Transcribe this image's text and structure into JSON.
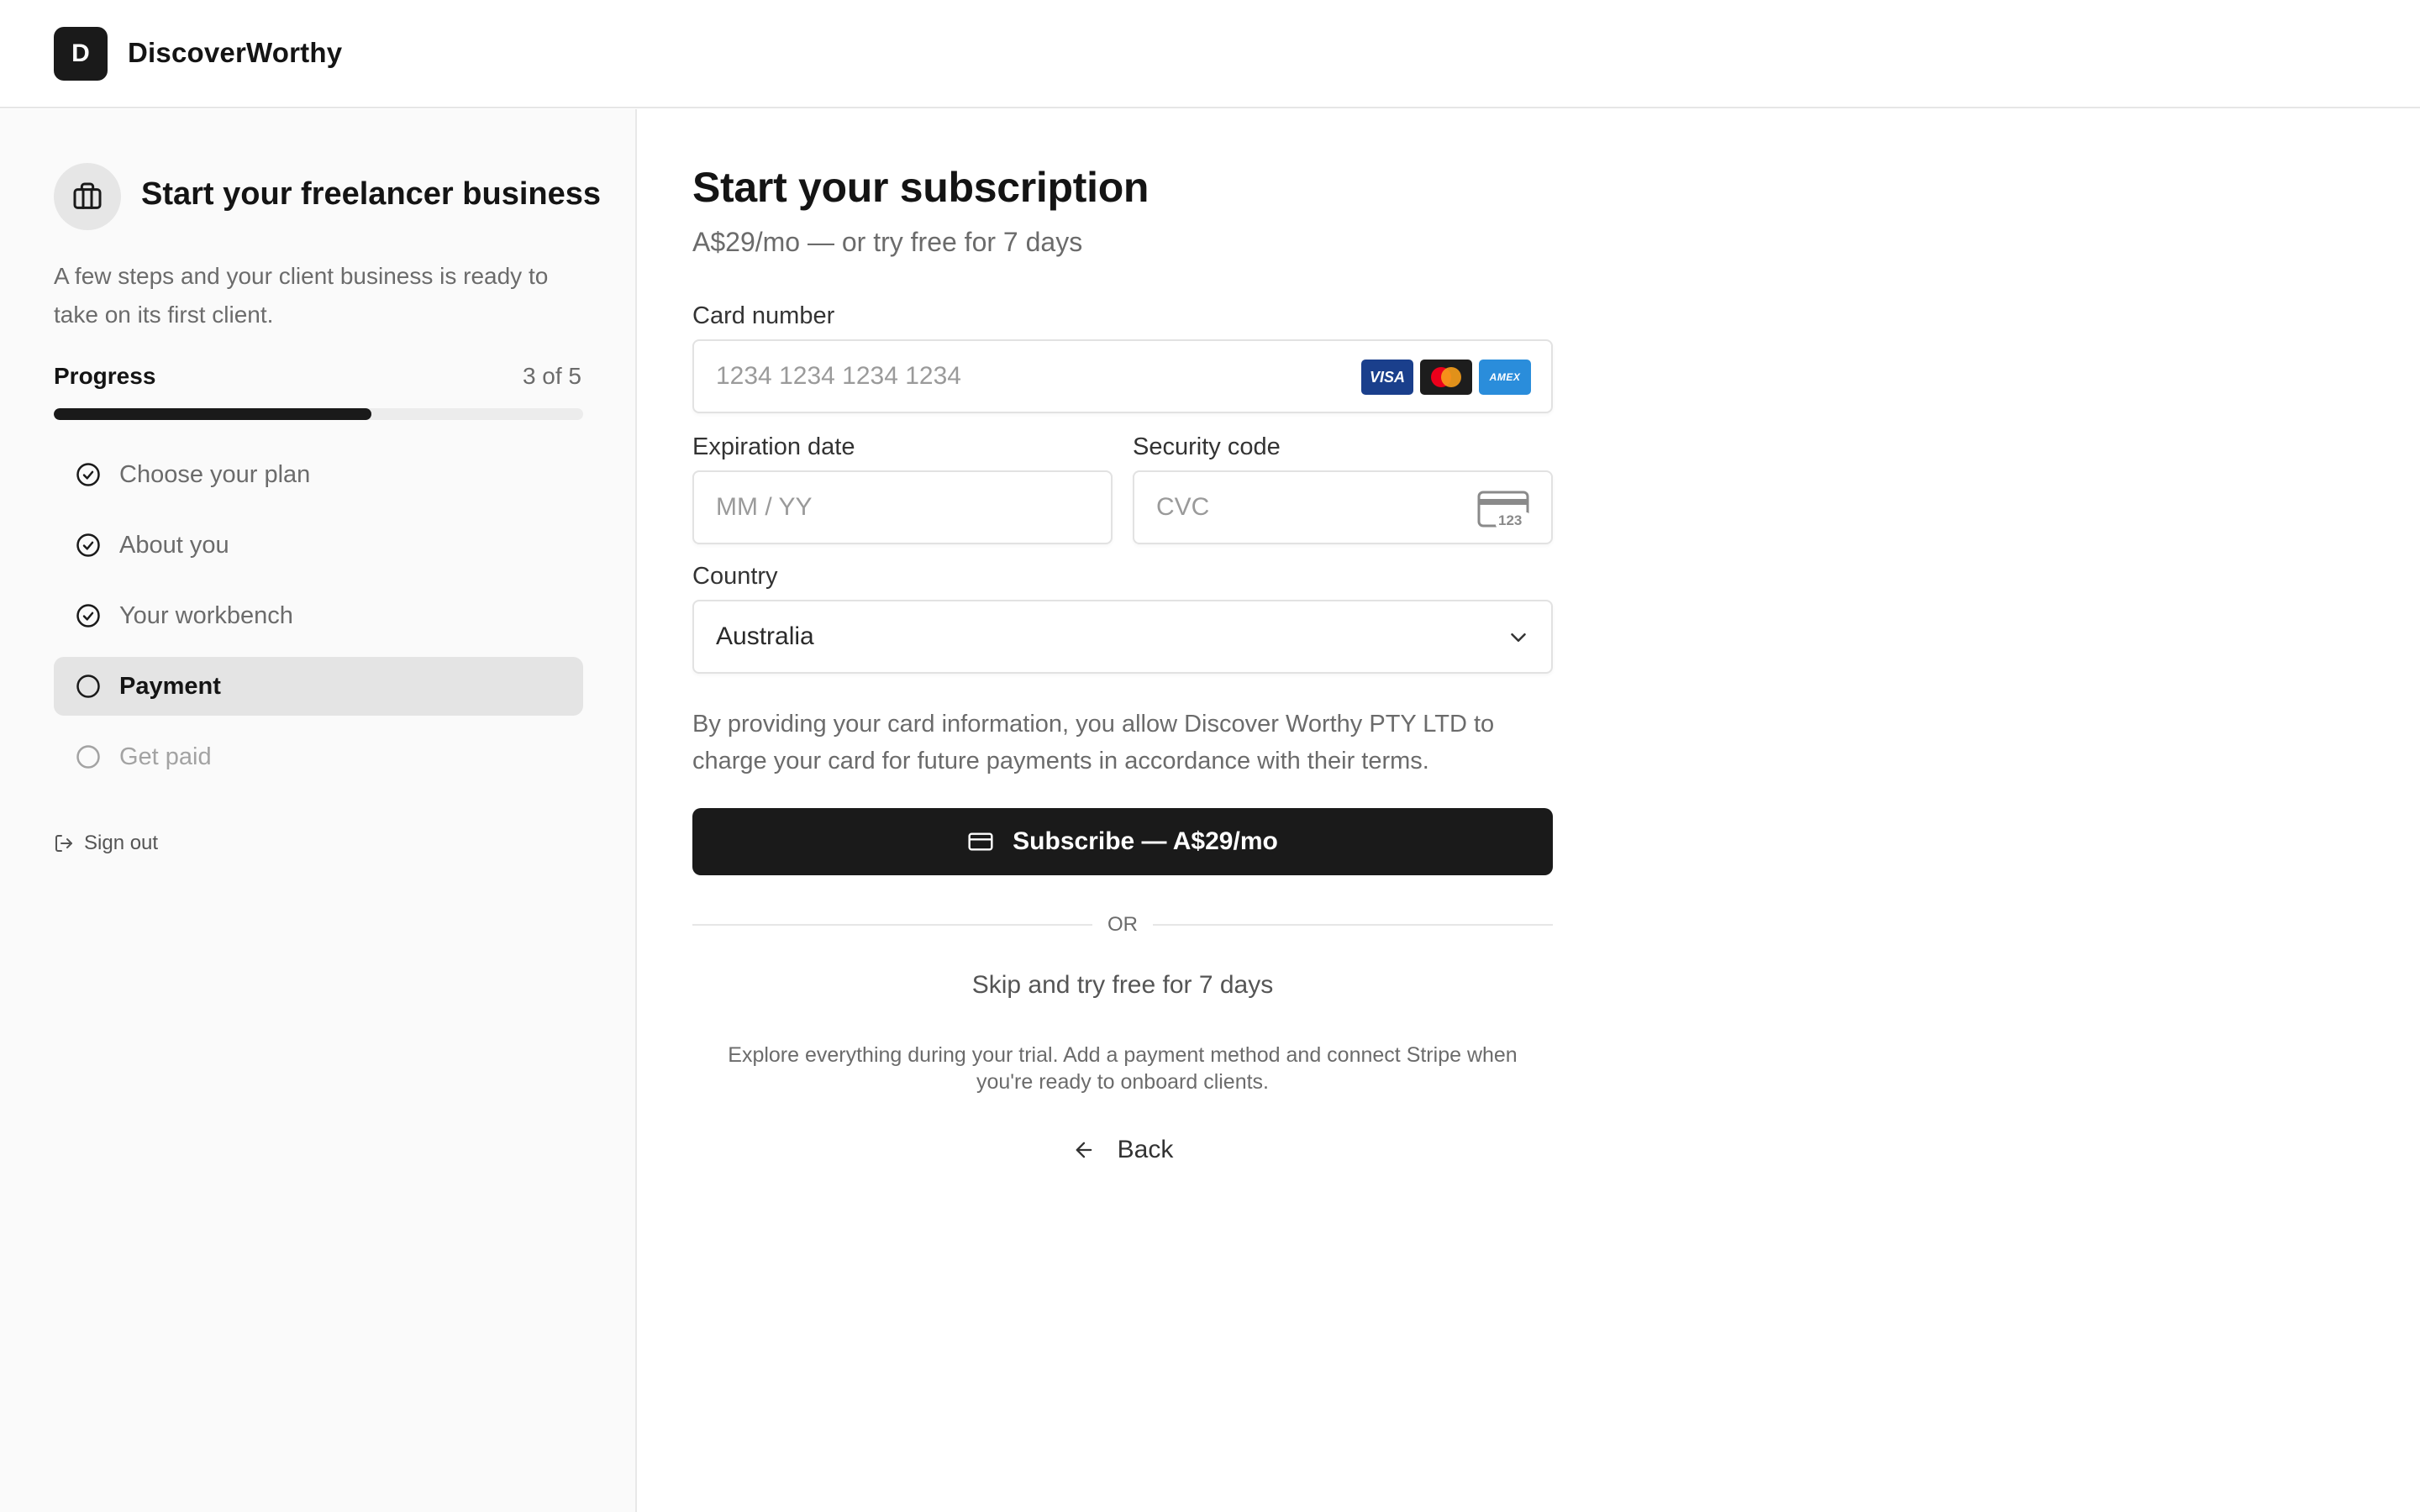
{
  "header": {
    "logo_letter": "D",
    "brand": "DiscoverWorthy"
  },
  "sidebar": {
    "icon": "briefcase-icon",
    "title": "Start your freelancer business",
    "description": "A few steps and your client business is ready to take on its first client.",
    "progress": {
      "label": "Progress",
      "count": "3 of 5",
      "completed": 3,
      "total": 5,
      "fraction": 0.6
    },
    "steps": [
      {
        "label": "Choose your plan",
        "status": "done",
        "icon": "check-circle-icon"
      },
      {
        "label": "About you",
        "status": "done",
        "icon": "check-circle-icon"
      },
      {
        "label": "Your workbench",
        "status": "done",
        "icon": "check-circle-icon"
      },
      {
        "label": "Payment",
        "status": "active",
        "icon": "circle-icon"
      },
      {
        "label": "Get paid",
        "status": "pending",
        "icon": "circle-icon"
      }
    ],
    "signout": {
      "label": "Sign out",
      "icon": "log-out-icon"
    }
  },
  "main": {
    "title": "Start your subscription",
    "subtitle": "A$29/mo — or try free for 7 days",
    "card_number": {
      "label": "Card number",
      "placeholder": "1234 1234 1234 1234",
      "brands": [
        "VISA",
        "mastercard",
        "AMEX"
      ]
    },
    "expiration": {
      "label": "Expiration date",
      "placeholder": "MM / YY"
    },
    "security": {
      "label": "Security code",
      "placeholder": "CVC",
      "icon_text": "123"
    },
    "country": {
      "label": "Country",
      "value": "Australia"
    },
    "legal": "By providing your card information, you allow Discover Worthy PTY LTD to charge your card for future payments in accordance with their terms.",
    "subscribe_label": "Subscribe — A$29/mo",
    "or_label": "OR",
    "skip_label": "Skip and try free for 7 days",
    "explore_text": "Explore everything during your trial. Add a payment method and connect Stripe when you're ready to onboard clients.",
    "back_label": "Back"
  },
  "colors": {
    "accent": "#1a1a1a",
    "sidebar_bg": "#fafafa",
    "active_step_bg": "#e4e4e4",
    "muted_text": "#6b6b6b"
  }
}
